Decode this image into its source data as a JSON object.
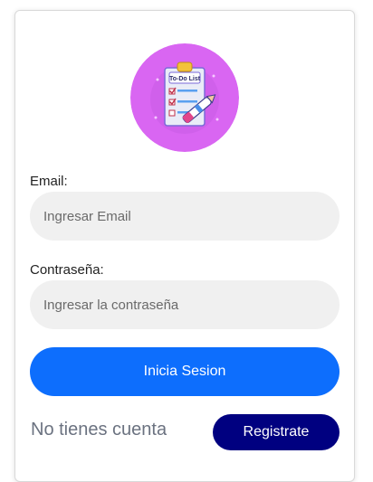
{
  "logo": {
    "icon": "todo-list-clipboard-icon",
    "text": "To-Do List",
    "circle_color": "#d966f2"
  },
  "form": {
    "email_label": "Email:",
    "email_placeholder": "Ingresar Email",
    "email_value": "",
    "password_label": "Contraseña:",
    "password_placeholder": "Ingresar la contraseña",
    "password_value": "",
    "input_bg_color": "#f0f0f0"
  },
  "login_button": {
    "label": "Inicia Sesion",
    "color": "#0d6efd"
  },
  "footer": {
    "no_account_text": "No tienes cuenta",
    "register_label": "Registrate",
    "register_color": "#000080"
  }
}
